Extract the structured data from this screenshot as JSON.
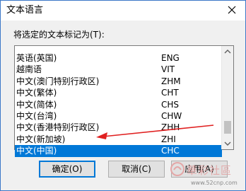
{
  "window": {
    "title": "文本语言"
  },
  "prompt": "将选定的文本标记为(T):",
  "languages": [
    {
      "name": "英语(英国)",
      "code": "ENG"
    },
    {
      "name": "越南语",
      "code": "VIT"
    },
    {
      "name": "中文(澳门特别行政区)",
      "code": "ZHM"
    },
    {
      "name": "中文(繁体)",
      "code": "CHT"
    },
    {
      "name": "中文(简体)",
      "code": "CHS"
    },
    {
      "name": "中文(台湾)",
      "code": "CHW"
    },
    {
      "name": "中文(香港特别行政区)",
      "code": "ZHH"
    },
    {
      "name": "中文(新加坡)",
      "code": "ZHI"
    },
    {
      "name": "中文(中国)",
      "code": "CHC"
    }
  ],
  "selected_code": "CHC",
  "buttons": {
    "ok": "确定(O)",
    "cancel": "取消(C)",
    "apply": "应用(A)"
  },
  "watermark": {
    "text": "華彩社區",
    "url": "www.52cnp.com"
  },
  "colors": {
    "selection": "#0078d7",
    "annotation_arrow": "#e02020",
    "default_button_border": "#0078d7"
  },
  "icons": {
    "close": "close-icon",
    "scroll_up": "chevron-up-icon",
    "scroll_down": "chevron-down-icon"
  }
}
